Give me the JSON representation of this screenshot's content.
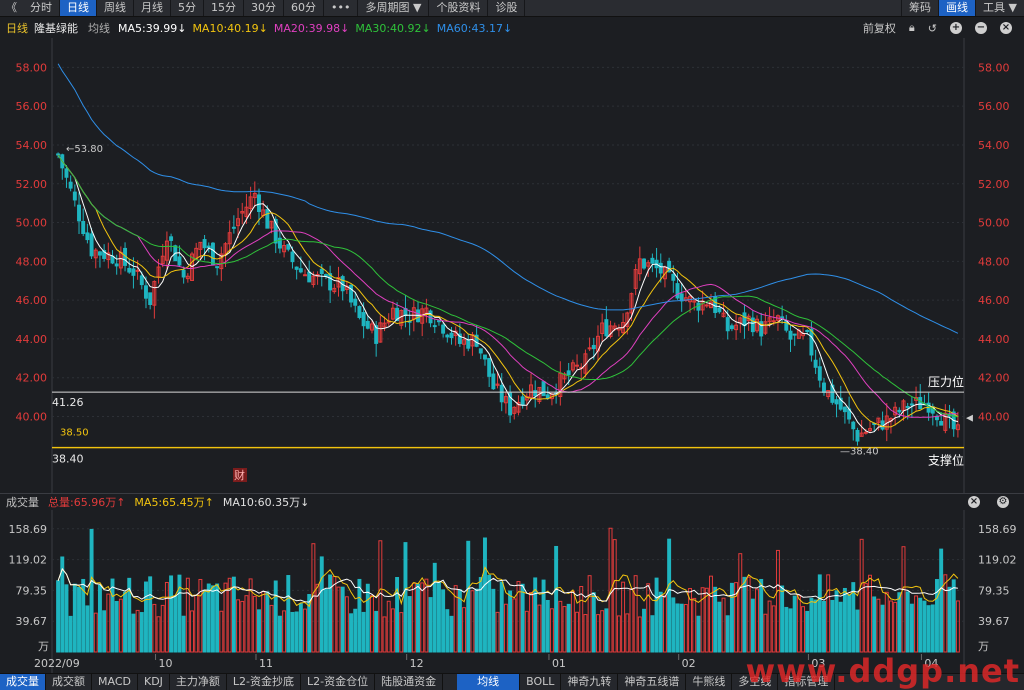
{
  "toolbar": {
    "back": "《",
    "buttons": [
      "分时",
      "日线",
      "周线",
      "月线",
      "5分",
      "15分",
      "30分",
      "60分",
      "•••",
      "多周期图 ▼",
      "个股资料",
      "诊股"
    ],
    "right_buttons": [
      "筹码",
      "画线",
      "工具 ▼"
    ]
  },
  "info": {
    "period": "日线",
    "stock_name": "隆基绿能",
    "avg_label": "均线",
    "ma5": "MA5:39.99↓",
    "ma10": "MA10:40.19↓",
    "ma20": "MA20:39.98↓",
    "ma30": "MA30:40.92↓",
    "ma60": "MA60:43.17↓",
    "adjust": "前复权"
  },
  "volume_header": {
    "title": "成交量",
    "total": "总量:65.96万↑",
    "ma5": "MA5:65.45万↑",
    "ma10": "MA10:60.35万↓"
  },
  "chart_labels": {
    "high_mark": "53.80",
    "low_mark": "38.40",
    "resistance_value": "41.26",
    "support_value": "38.40",
    "ref_line_value": "38.50",
    "resistance_text": "压力位",
    "support_text": "支撑位",
    "cai_badge": "财",
    "vol_unit": "万"
  },
  "chart_data": [
    {
      "type": "candlestick",
      "title": "隆基绿能 日线",
      "ylim": [
        37.5,
        59.0
      ],
      "y_ticks": [
        "58.00",
        "56.00",
        "54.00",
        "52.00",
        "50.00",
        "48.00",
        "46.00",
        "44.00",
        "42.00",
        "40.00"
      ],
      "x_ticks": [
        "2022/09",
        "10",
        "11",
        "12",
        "01",
        "02",
        "03",
        "04"
      ],
      "grid": true,
      "series": [
        {
          "name": "MA5",
          "color": "#ffffff"
        },
        {
          "name": "MA10",
          "color": "#f2c40f"
        },
        {
          "name": "MA20",
          "color": "#e040c0"
        },
        {
          "name": "MA30",
          "color": "#2fc23a"
        },
        {
          "name": "MA60",
          "color": "#2f8fe8"
        }
      ],
      "horizontal_lines": [
        41.26,
        38.4,
        38.5
      ],
      "annotated_high": 53.8,
      "annotated_low": 38.4
    },
    {
      "type": "bar",
      "title": "成交量",
      "ylim": [
        0,
        170
      ],
      "y_ticks": [
        "158.69",
        "119.02",
        "79.35",
        "39.67"
      ],
      "series": [
        {
          "name": "MA5",
          "color": "#f2c40f"
        },
        {
          "name": "MA10",
          "color": "#ffffff"
        }
      ]
    }
  ],
  "tabs": [
    "成交量",
    "成交额",
    "MACD",
    "KDJ",
    "主力净额",
    "L2-资金抄底",
    "L2-资金仓位",
    "陆股通资金",
    "",
    "均线",
    "BOLL",
    "神奇九转",
    "神奇五线谱",
    "牛熊线",
    "多空线",
    "指标管理"
  ],
  "watermark": "www.ddgp.net",
  "colors": {
    "up": "#e23b3b",
    "down": "#1fb5c0",
    "accent": "#1d62c4"
  }
}
